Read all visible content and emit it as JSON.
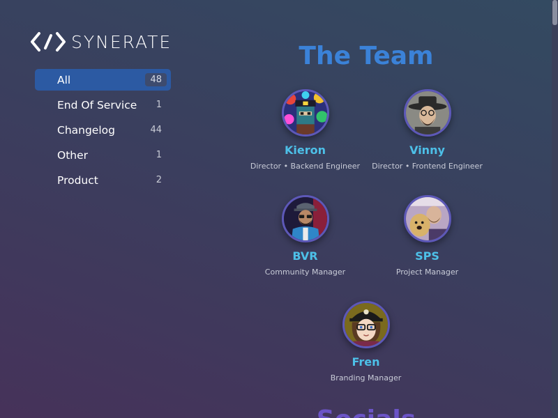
{
  "logo": {
    "text": "SYNERATE",
    "icon": "synerate-logo-icon"
  },
  "categories": [
    {
      "label": "All",
      "count": "48",
      "active": true
    },
    {
      "label": "End Of Service",
      "count": "1"
    },
    {
      "label": "Changelog",
      "count": "44"
    },
    {
      "label": "Other",
      "count": "1"
    },
    {
      "label": "Product",
      "count": "2"
    }
  ],
  "team": {
    "title": "The Team",
    "members": [
      {
        "name": "Kieron",
        "role": "Director • Backend Engineer",
        "avatar": "kieron-avatar"
      },
      {
        "name": "Vinny",
        "role": "Director • Frontend Engineer",
        "avatar": "vinny-avatar"
      },
      {
        "name": "BVR",
        "role": "Community Manager",
        "avatar": "bvr-avatar"
      },
      {
        "name": "SPS",
        "role": "Project Manager",
        "avatar": "sps-avatar"
      },
      {
        "name": "Fren",
        "role": "Branding Manager",
        "avatar": "fren-avatar"
      }
    ]
  },
  "socials": {
    "title": "Socials"
  },
  "colors": {
    "accent_blue": "#3b82d8",
    "name_cyan": "#4dc0e8",
    "active_item": "#2c5aa3",
    "socials_purple": "#6b54c6"
  }
}
